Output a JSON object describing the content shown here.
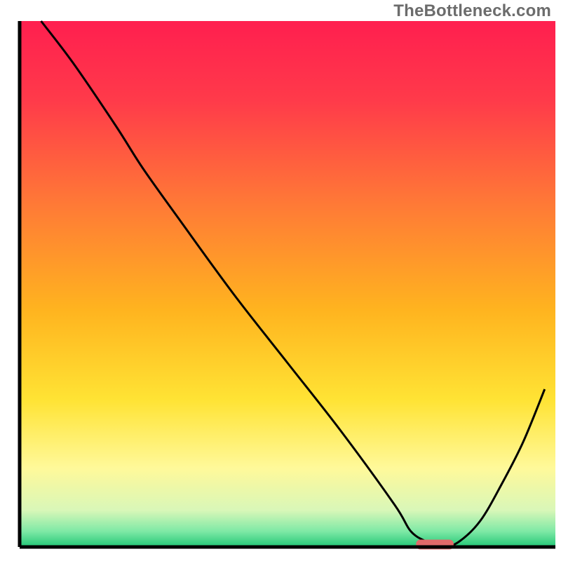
{
  "watermark": {
    "text": "TheBottleneck.com"
  },
  "colors": {
    "gradient_stops": [
      {
        "offset": 0.0,
        "color": "#ff1f4f"
      },
      {
        "offset": 0.15,
        "color": "#ff3a4a"
      },
      {
        "offset": 0.35,
        "color": "#ff7a36"
      },
      {
        "offset": 0.55,
        "color": "#ffb41f"
      },
      {
        "offset": 0.72,
        "color": "#ffe334"
      },
      {
        "offset": 0.85,
        "color": "#fff99a"
      },
      {
        "offset": 0.93,
        "color": "#d9f7b8"
      },
      {
        "offset": 0.97,
        "color": "#7fe9a6"
      },
      {
        "offset": 1.0,
        "color": "#22c776"
      }
    ],
    "axis": "#000000",
    "curve": "#000000",
    "marker": "#e26a6a"
  },
  "chart_data": {
    "type": "line",
    "title": "",
    "xlabel": "",
    "ylabel": "",
    "xlim": [
      0,
      100
    ],
    "ylim": [
      0,
      100
    ],
    "grid": false,
    "legend": false,
    "series": [
      {
        "name": "bottleneck-curve",
        "x": [
          4,
          10,
          18,
          23,
          30,
          40,
          50,
          60,
          70,
          73,
          76,
          79,
          82,
          86,
          90,
          94,
          98
        ],
        "y": [
          100,
          92,
          80,
          72,
          62,
          48,
          35,
          22,
          8,
          3,
          1,
          0,
          1,
          5,
          12,
          20,
          30
        ]
      }
    ],
    "marker": {
      "x_start": 74,
      "x_end": 81,
      "y": 0.6
    }
  }
}
